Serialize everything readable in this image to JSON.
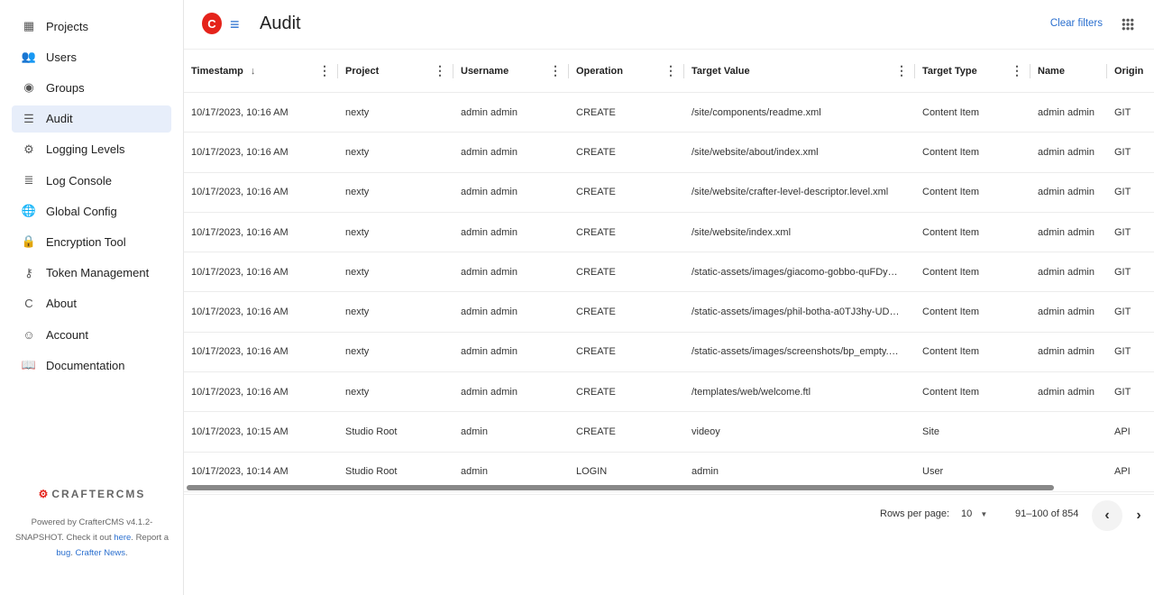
{
  "sidebar": {
    "items": [
      {
        "label": "Projects",
        "icon": "projects-icon",
        "glyph": "▦"
      },
      {
        "label": "Users",
        "icon": "users-icon",
        "glyph": "👥"
      },
      {
        "label": "Groups",
        "icon": "groups-icon",
        "glyph": "◉"
      },
      {
        "label": "Audit",
        "icon": "audit-icon",
        "glyph": "☰",
        "selected": true
      },
      {
        "label": "Logging Levels",
        "icon": "logging-levels-icon",
        "glyph": "⚙"
      },
      {
        "label": "Log Console",
        "icon": "log-console-icon",
        "glyph": "≣"
      },
      {
        "label": "Global Config",
        "icon": "globe-icon",
        "glyph": "🌐"
      },
      {
        "label": "Encryption Tool",
        "icon": "lock-icon",
        "glyph": "🔒"
      },
      {
        "label": "Token Management",
        "icon": "key-icon",
        "glyph": "⚷"
      },
      {
        "label": "About",
        "icon": "crafter-icon",
        "glyph": "C"
      },
      {
        "label": "Account",
        "icon": "account-icon",
        "glyph": "☺"
      },
      {
        "label": "Documentation",
        "icon": "documentation-icon",
        "glyph": "📖"
      }
    ],
    "footer": {
      "logo": "CRAFTERCMS",
      "text1": "Powered by CrafterCMS v4.1.2-SNAPSHOT. Check it out ",
      "here": "here",
      "text2": ". Report a ",
      "bug": "bug",
      "text3": ". ",
      "news": "Crafter News",
      "text4": "."
    }
  },
  "header": {
    "title": "Audit",
    "clear_filters": "Clear filters"
  },
  "colors": {
    "accent": "#2a6fcf",
    "brand": "#e5231b"
  },
  "table": {
    "columns": [
      "Timestamp",
      "Project",
      "Username",
      "Operation",
      "Target Value",
      "Target Type",
      "Name",
      "Origin"
    ],
    "rows": [
      [
        "10/17/2023, 10:16 AM",
        "nexty",
        "admin admin",
        "CREATE",
        "/site/components/readme.xml",
        "Content Item",
        "admin admin",
        "GIT"
      ],
      [
        "10/17/2023, 10:16 AM",
        "nexty",
        "admin admin",
        "CREATE",
        "/site/website/about/index.xml",
        "Content Item",
        "admin admin",
        "GIT"
      ],
      [
        "10/17/2023, 10:16 AM",
        "nexty",
        "admin admin",
        "CREATE",
        "/site/website/crafter-level-descriptor.level.xml",
        "Content Item",
        "admin admin",
        "GIT"
      ],
      [
        "10/17/2023, 10:16 AM",
        "nexty",
        "admin admin",
        "CREATE",
        "/site/website/index.xml",
        "Content Item",
        "admin admin",
        "GIT"
      ],
      [
        "10/17/2023, 10:16 AM",
        "nexty",
        "admin admin",
        "CREATE",
        "/static-assets/images/giacomo-gobbo-quFDy…",
        "Content Item",
        "admin admin",
        "GIT"
      ],
      [
        "10/17/2023, 10:16 AM",
        "nexty",
        "admin admin",
        "CREATE",
        "/static-assets/images/phil-botha-a0TJ3hy-UD…",
        "Content Item",
        "admin admin",
        "GIT"
      ],
      [
        "10/17/2023, 10:16 AM",
        "nexty",
        "admin admin",
        "CREATE",
        "/static-assets/images/screenshots/bp_empty.…",
        "Content Item",
        "admin admin",
        "GIT"
      ],
      [
        "10/17/2023, 10:16 AM",
        "nexty",
        "admin admin",
        "CREATE",
        "/templates/web/welcome.ftl",
        "Content Item",
        "admin admin",
        "GIT"
      ],
      [
        "10/17/2023, 10:15 AM",
        "Studio Root",
        "admin",
        "",
        "CREATE",
        "videoy",
        "Site",
        "API"
      ],
      [
        "10/17/2023, 10:14 AM",
        "Studio Root",
        "admin",
        "",
        "LOGIN",
        "admin",
        "User",
        "API"
      ]
    ]
  },
  "pagination": {
    "rows_per_page_label": "Rows per page:",
    "rows_per_page": "10",
    "range": "91–100 of 854"
  }
}
